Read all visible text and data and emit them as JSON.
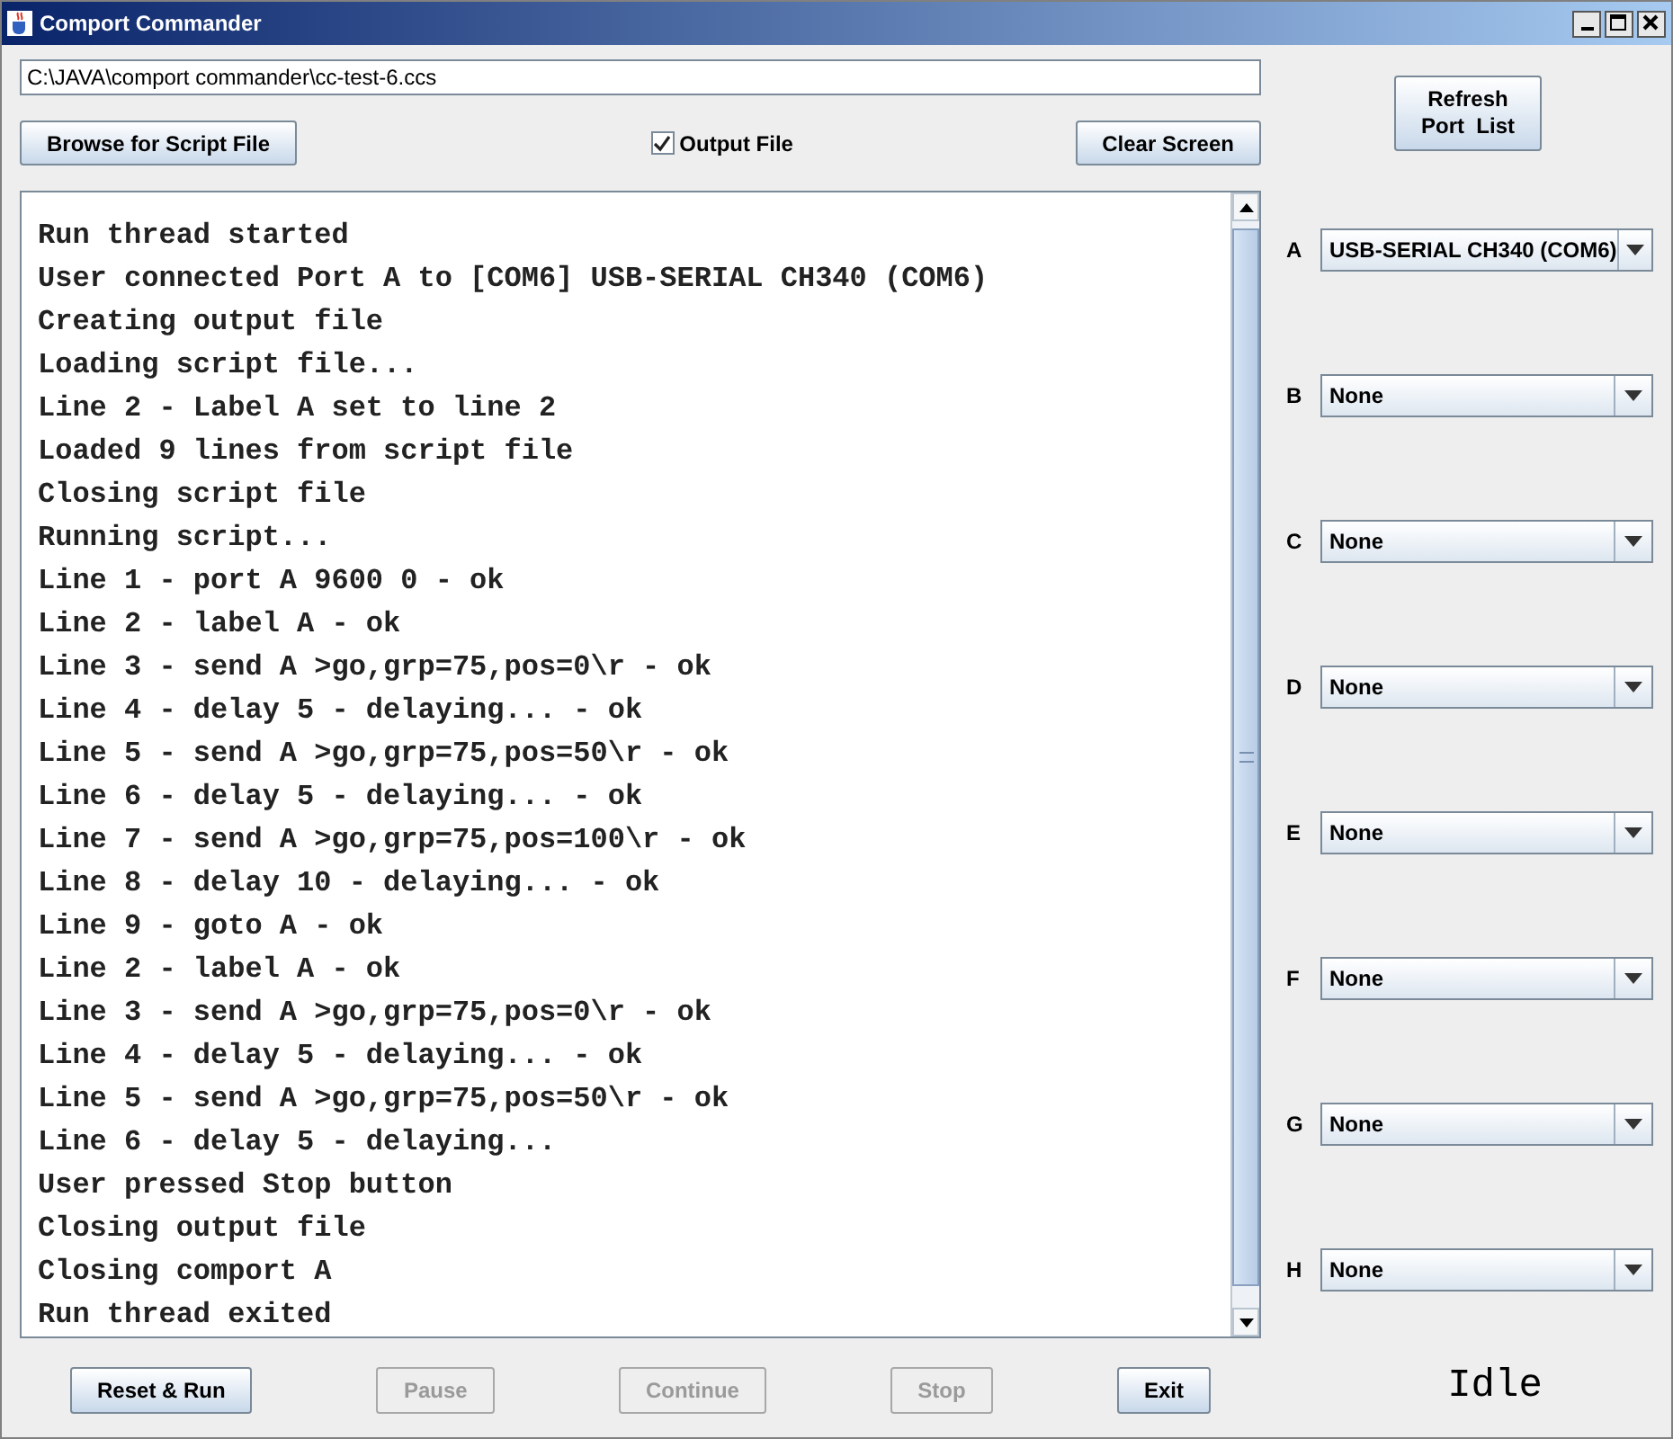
{
  "window": {
    "title": "Comport Commander"
  },
  "script_path": {
    "value": "C:\\JAVA\\comport commander\\cc-test-6.ccs"
  },
  "browse_button": {
    "label": "Browse for Script File"
  },
  "output_file": {
    "label": "Output File",
    "checked": true
  },
  "clear_button": {
    "label": "Clear Screen"
  },
  "refresh_button": {
    "label": "Refresh\nPort  List"
  },
  "console_lines": [
    "Run thread started",
    "User connected Port A to [COM6] USB-SERIAL CH340 (COM6)",
    "Creating output file",
    "Loading script file...",
    "Line 2 - Label A set to line 2",
    "Loaded 9 lines from script file",
    "Closing script file",
    "Running script...",
    "Line 1 - port A 9600 0 - ok",
    "Line 2 - label A - ok",
    "Line 3 - send A >go,grp=75,pos=0\\r - ok",
    "Line 4 - delay 5 - delaying... - ok",
    "Line 5 - send A >go,grp=75,pos=50\\r - ok",
    "Line 6 - delay 5 - delaying... - ok",
    "Line 7 - send A >go,grp=75,pos=100\\r - ok",
    "Line 8 - delay 10 - delaying... - ok",
    "Line 9 - goto A - ok",
    "Line 2 - label A - ok",
    "Line 3 - send A >go,grp=75,pos=0\\r - ok",
    "Line 4 - delay 5 - delaying... - ok",
    "Line 5 - send A >go,grp=75,pos=50\\r - ok",
    "Line 6 - delay 5 - delaying...",
    "User pressed Stop button",
    "Closing output file",
    "Closing comport A",
    "Run thread exited"
  ],
  "ports": [
    {
      "label": "A",
      "value": "USB-SERIAL CH340 (COM6)"
    },
    {
      "label": "B",
      "value": "None"
    },
    {
      "label": "C",
      "value": "None"
    },
    {
      "label": "D",
      "value": "None"
    },
    {
      "label": "E",
      "value": "None"
    },
    {
      "label": "F",
      "value": "None"
    },
    {
      "label": "G",
      "value": "None"
    },
    {
      "label": "H",
      "value": "None"
    }
  ],
  "controls": [
    {
      "label": "Reset & Run",
      "disabled": false
    },
    {
      "label": "Pause",
      "disabled": true
    },
    {
      "label": "Continue",
      "disabled": true
    },
    {
      "label": "Stop",
      "disabled": true
    },
    {
      "label": "Exit",
      "disabled": false
    }
  ],
  "status": "Idle"
}
